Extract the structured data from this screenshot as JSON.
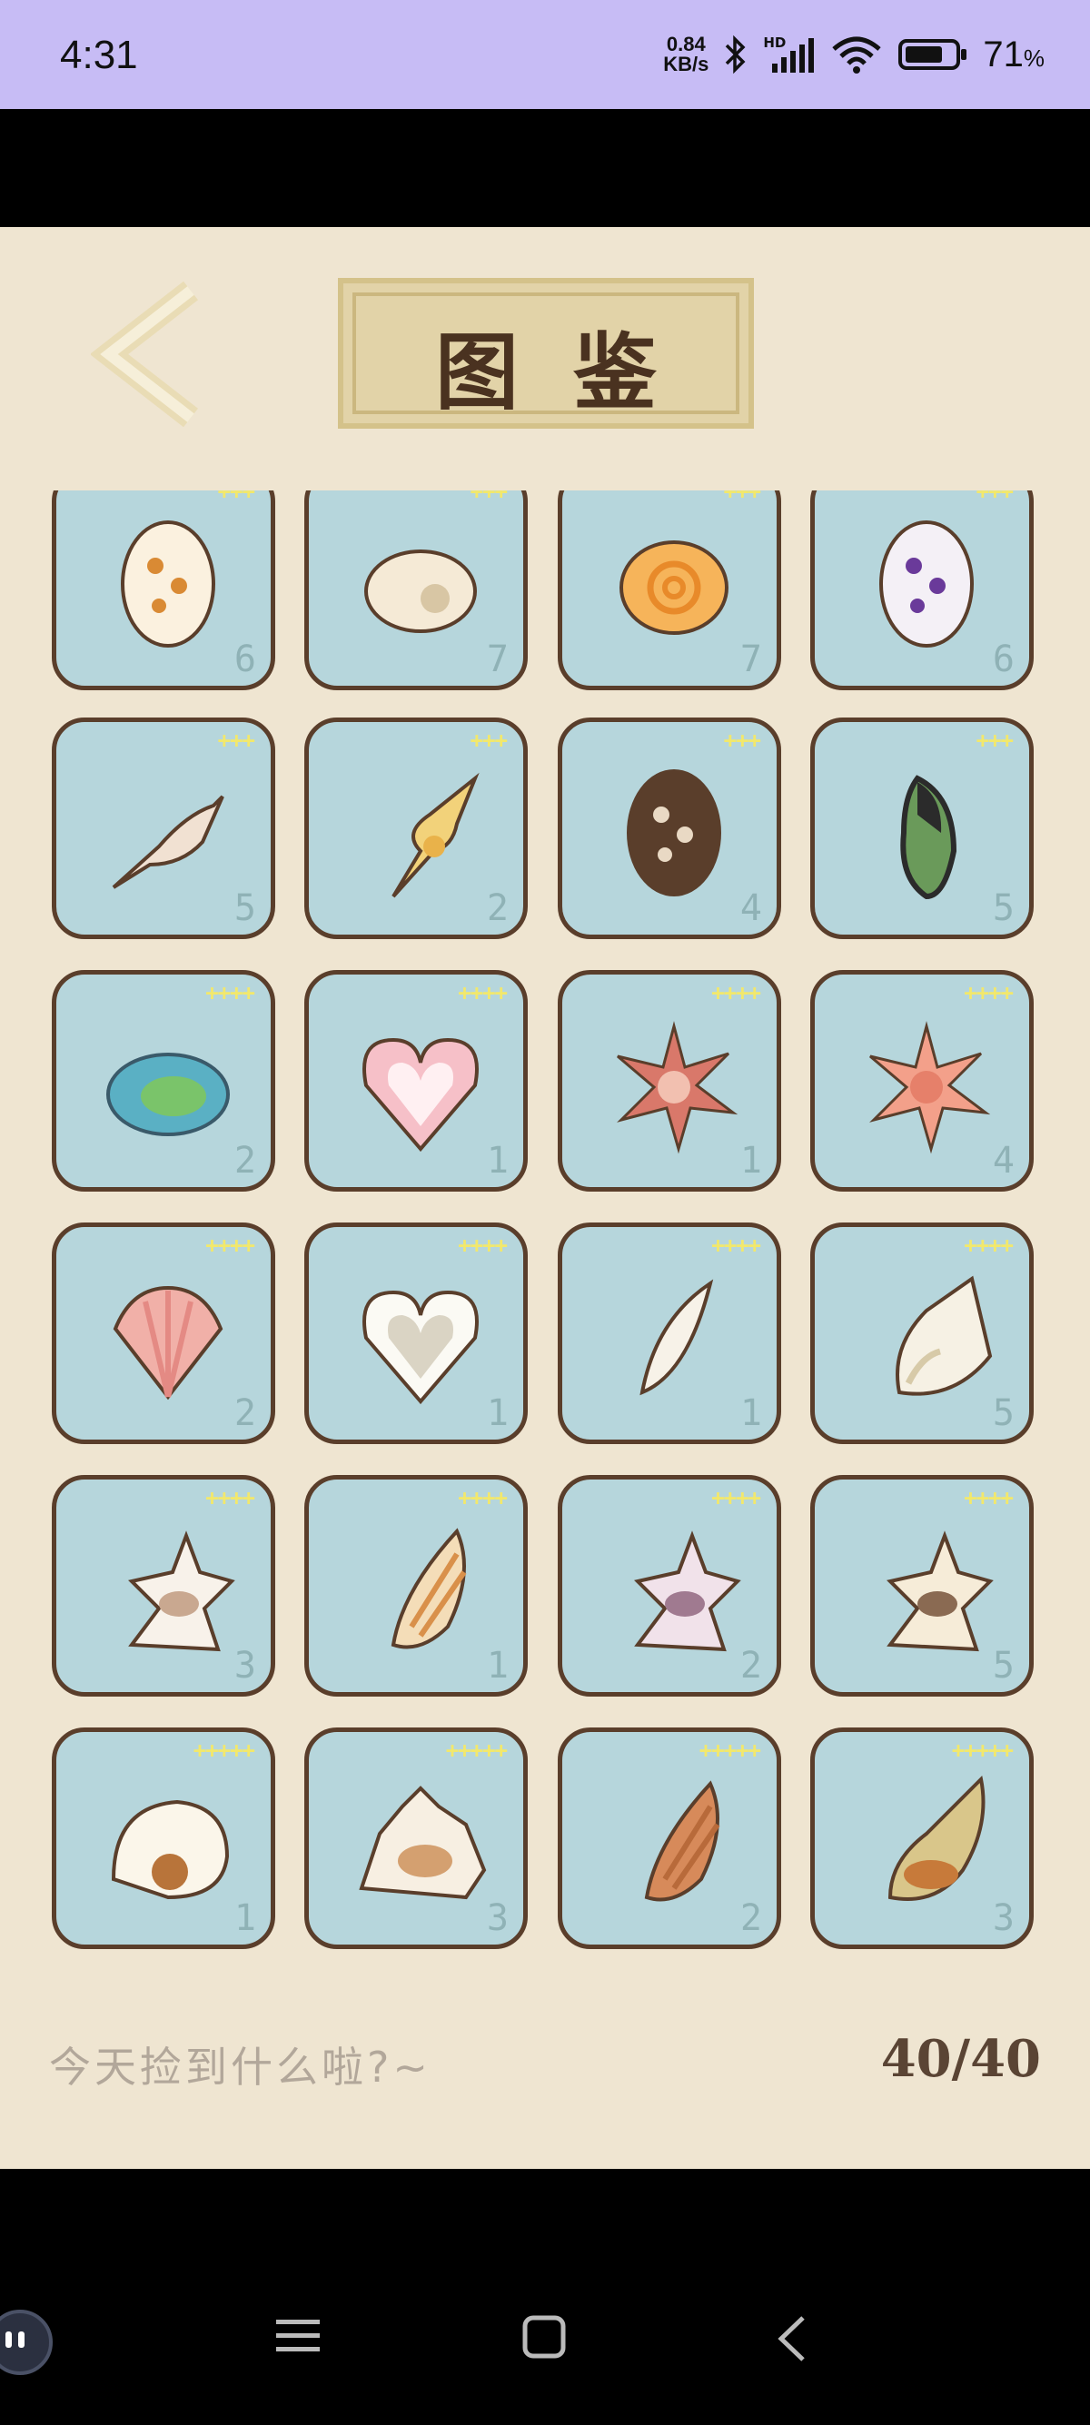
{
  "status_bar": {
    "time": "4:31",
    "net_speed_value": "0.84",
    "net_speed_unit": "KB/s",
    "signal_label": "HD",
    "battery_percent": "71",
    "battery_unit": "%"
  },
  "header": {
    "title": "图鉴",
    "back_icon": "chevron-left-icon"
  },
  "collection": {
    "items": [
      {
        "name": "spotted-cone-shell",
        "count": "6",
        "stars": "+++",
        "colors": [
          "#fbf1df",
          "#d98a34"
        ]
      },
      {
        "name": "cream-moon-shell",
        "count": "7",
        "stars": "+++",
        "colors": [
          "#f5ead6",
          "#d8c6a4"
        ]
      },
      {
        "name": "orange-spiral-shell",
        "count": "7",
        "stars": "+++",
        "colors": [
          "#f6b45a",
          "#e88a2a"
        ]
      },
      {
        "name": "purple-conch-shell",
        "count": "6",
        "stars": "+++",
        "colors": [
          "#f4f0f6",
          "#6a3a9a"
        ]
      },
      {
        "name": "spindle-shell",
        "count": "5",
        "stars": "+++",
        "colors": [
          "#f1e1d2",
          "#8a6a52"
        ]
      },
      {
        "name": "yellow-spire-shell",
        "count": "2",
        "stars": "+++",
        "colors": [
          "#f2d27a",
          "#e9b24a"
        ]
      },
      {
        "name": "star-limpet",
        "count": "4",
        "stars": "+++",
        "colors": [
          "#5a3e2b",
          "#e9d9c4"
        ]
      },
      {
        "name": "green-mussel",
        "count": "5",
        "stars": "+++",
        "colors": [
          "#2b2b2b",
          "#6a9a5a"
        ]
      },
      {
        "name": "abalone",
        "count": "2",
        "stars": "++++",
        "colors": [
          "#5ab0c4",
          "#7ac46a"
        ]
      },
      {
        "name": "heart-cockle",
        "count": "1",
        "stars": "++++",
        "colors": [
          "#f6c0c8",
          "#fff0f2"
        ]
      },
      {
        "name": "spiny-murex-red",
        "count": "1",
        "stars": "++++",
        "colors": [
          "#d9786a",
          "#f2c0b0"
        ]
      },
      {
        "name": "star-shell",
        "count": "4",
        "stars": "++++",
        "colors": [
          "#f3a08a",
          "#e6806a"
        ]
      },
      {
        "name": "scallop",
        "count": "2",
        "stars": "++++",
        "colors": [
          "#f1b0a8",
          "#e48a84"
        ]
      },
      {
        "name": "white-heart-shell",
        "count": "1",
        "stars": "++++",
        "colors": [
          "#fbfaf4",
          "#dad4c4"
        ]
      },
      {
        "name": "olive-shell",
        "count": "1",
        "stars": "++++",
        "colors": [
          "#f7f2e8",
          "#d8cdb8"
        ]
      },
      {
        "name": "white-conch",
        "count": "5",
        "stars": "++++",
        "colors": [
          "#f6f1e4",
          "#d7caa8"
        ]
      },
      {
        "name": "spiked-murex",
        "count": "3",
        "stars": "++++",
        "colors": [
          "#f8f2ea",
          "#c9a890"
        ]
      },
      {
        "name": "striped-cone",
        "count": "1",
        "stars": "++++",
        "colors": [
          "#f4ddb8",
          "#d9904a"
        ]
      },
      {
        "name": "pink-murex",
        "count": "2",
        "stars": "++++",
        "colors": [
          "#f1e2ea",
          "#a07a90"
        ]
      },
      {
        "name": "long-spine-murex",
        "count": "5",
        "stars": "++++",
        "colors": [
          "#f6ecd8",
          "#8a6a52"
        ]
      },
      {
        "name": "nautilus",
        "count": "1",
        "stars": "+++++",
        "colors": [
          "#fbf6ea",
          "#b8743a"
        ]
      },
      {
        "name": "crown-conch",
        "count": "3",
        "stars": "+++++",
        "colors": [
          "#f7efe2",
          "#d4a070"
        ]
      },
      {
        "name": "textile-cone",
        "count": "2",
        "stars": "+++++",
        "colors": [
          "#d78a5a",
          "#b86a3a"
        ]
      },
      {
        "name": "tun-whelk",
        "count": "3",
        "stars": "+++++",
        "colors": [
          "#d9c68a",
          "#c77a3a"
        ]
      }
    ]
  },
  "footer": {
    "prompt": "今天捡到什么啦?~",
    "progress": "40/40"
  },
  "nav": {
    "menu_icon": "menu-icon",
    "home_icon": "home-square-icon",
    "back_icon": "back-triangle-icon"
  }
}
